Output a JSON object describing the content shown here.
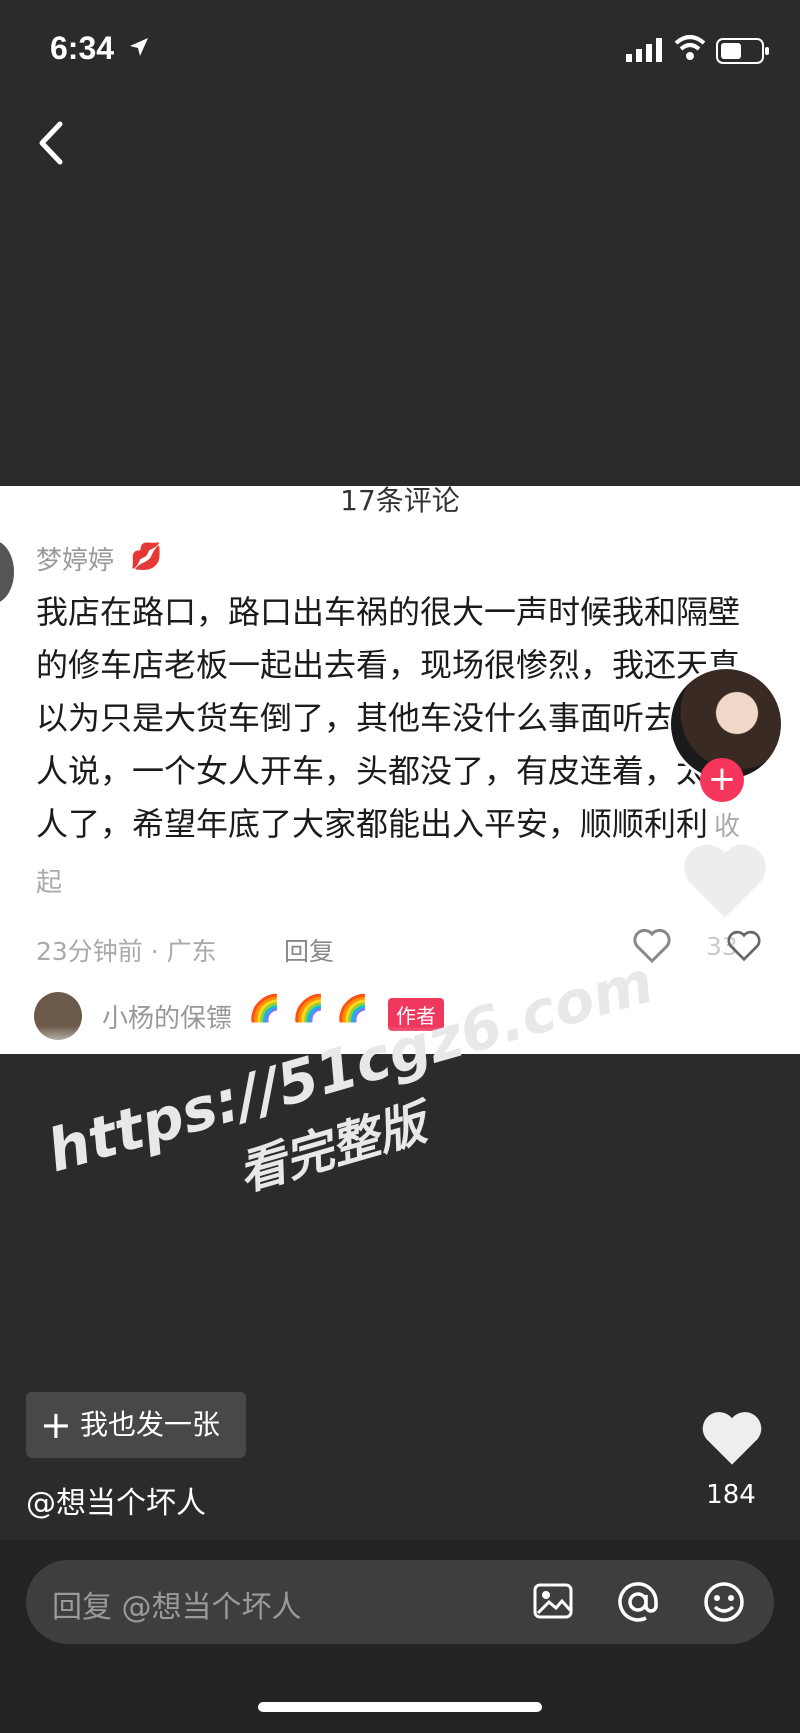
{
  "status_bar": {
    "time": "6:34",
    "icons": [
      "location-arrow-icon",
      "signal-icon",
      "wifi-icon",
      "battery-icon"
    ]
  },
  "nav": {
    "back_icon": "chevron-left-icon"
  },
  "screenshot": {
    "title": "17条评论",
    "comment": {
      "username": "梦婷婷",
      "emoji": "💋",
      "text": "我店在路口，路口出车祸的很大一声时候我和隔壁的修车店老板一起出去看，现场很惨烈，我还天真以为只是大货车倒了，其他车没什么事面听去看的人说，一个女人开车，头都没了，有皮连着，太吓人了，希望年底了大家都能出入平安，顺顺利利",
      "fold_label": "收起",
      "meta": "23分钟前 · 广东",
      "reply_label": "回复",
      "like_count": "33"
    },
    "reply": {
      "username": "小杨的保镖",
      "emoji": "🌈",
      "badge": "作者"
    }
  },
  "watermark": {
    "line1": "https://51cgz6.com",
    "line2": "看完整版"
  },
  "post_button": {
    "label": "我也发一张"
  },
  "author_handle": "@想当个坏人",
  "like": {
    "count": "184"
  },
  "reply_input": {
    "placeholder": "回复 @想当个坏人"
  },
  "toolbar": {
    "icons": [
      "image-icon",
      "at-icon",
      "emoji-icon"
    ]
  }
}
